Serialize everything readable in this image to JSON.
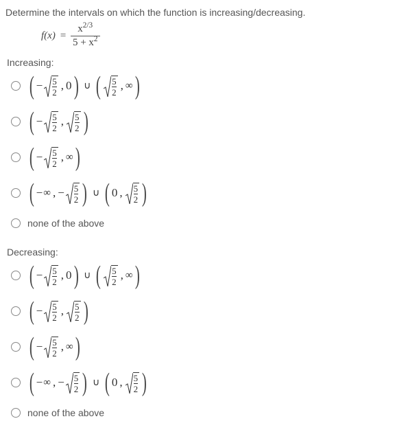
{
  "prompt": "Determine the intervals on which the function is increasing/decreasing.",
  "func": {
    "lhs": "f(x)",
    "eq": "=",
    "num_base": "x",
    "num_exp": "2/3",
    "den_a": "5",
    "den_plus": " + ",
    "den_b": "x",
    "den_exp": "2"
  },
  "labelInc": "Increasing:",
  "labelDec": "Decreasing:",
  "sym": {
    "neg": "−",
    "comma": ",",
    "union": "∪",
    "inf": "∞",
    "zero": "0",
    "fracN": "5",
    "fracD": "2"
  },
  "noneText": "none of the above"
}
